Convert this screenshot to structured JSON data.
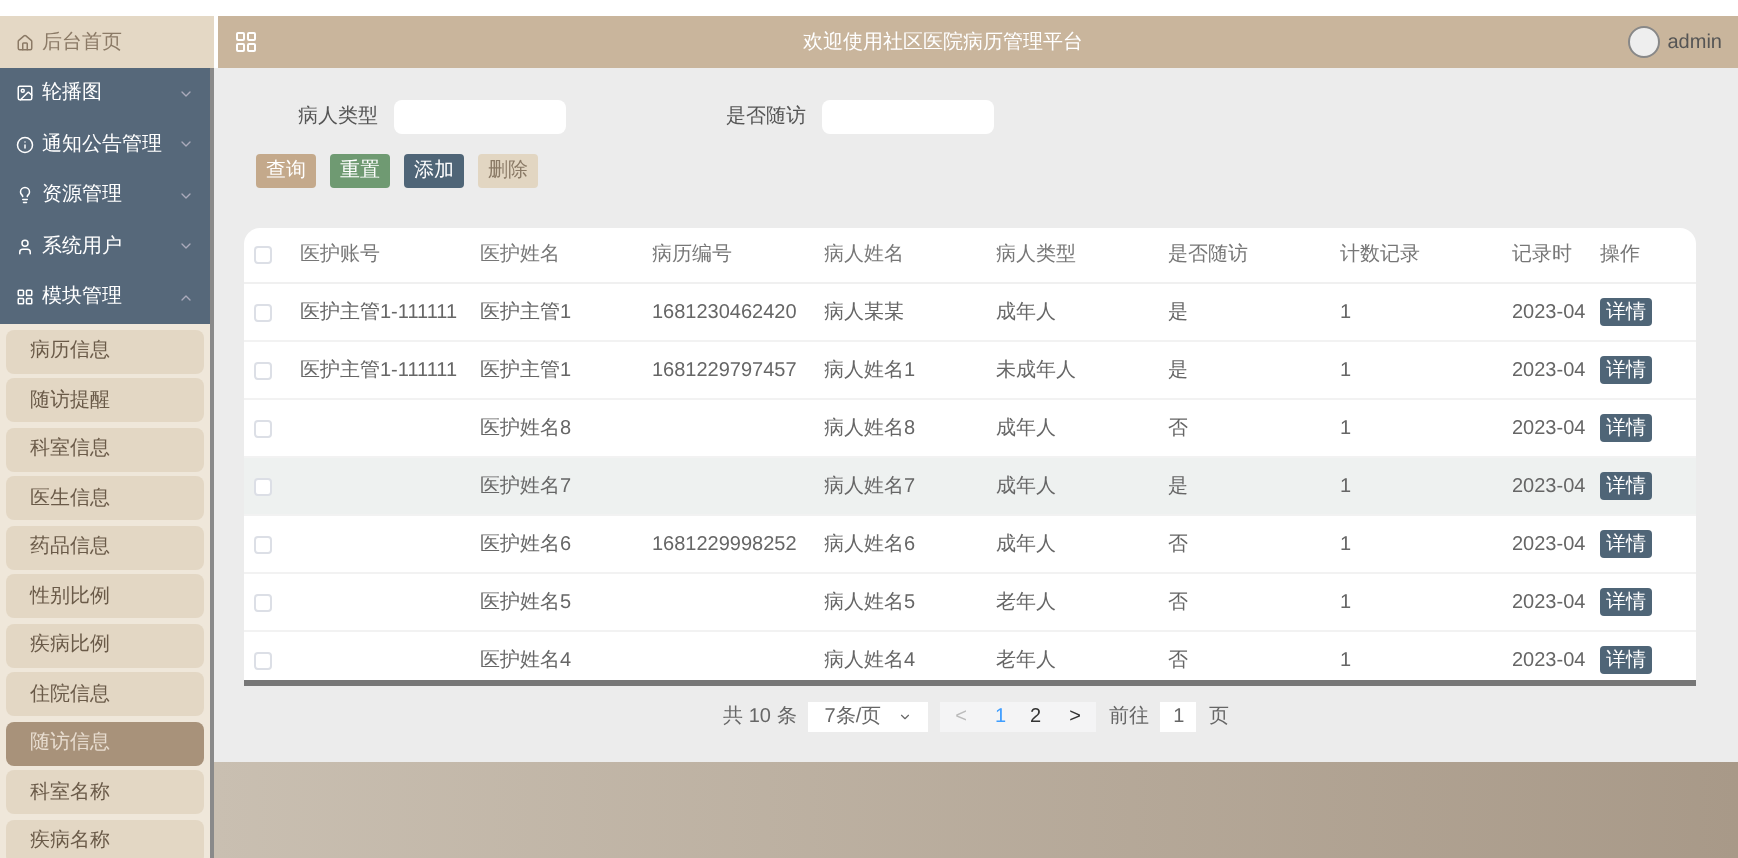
{
  "header": {
    "home": "后台首页",
    "title": "欢迎使用社区医院病历管理平台",
    "user": "admin"
  },
  "sidebar": {
    "groups": [
      {
        "label": "轮播图",
        "expanded": false
      },
      {
        "label": "通知公告管理",
        "expanded": false
      },
      {
        "label": "资源管理",
        "expanded": false
      },
      {
        "label": "系统用户",
        "expanded": false
      },
      {
        "label": "模块管理",
        "expanded": true,
        "children": [
          {
            "label": "病历信息",
            "selected": false
          },
          {
            "label": "随访提醒",
            "selected": false
          },
          {
            "label": "科室信息",
            "selected": false
          },
          {
            "label": "医生信息",
            "selected": false
          },
          {
            "label": "药品信息",
            "selected": false
          },
          {
            "label": "性别比例",
            "selected": false
          },
          {
            "label": "疾病比例",
            "selected": false
          },
          {
            "label": "住院信息",
            "selected": false
          },
          {
            "label": "随访信息",
            "selected": true
          },
          {
            "label": "科室名称",
            "selected": false
          },
          {
            "label": "疾病名称",
            "selected": false
          }
        ]
      }
    ]
  },
  "filters": [
    {
      "label": "病人类型"
    },
    {
      "label": "是否随访"
    }
  ],
  "buttons": [
    {
      "label": "查询",
      "kind": "search",
      "disabled": false
    },
    {
      "label": "重置",
      "kind": "reset",
      "disabled": false
    },
    {
      "label": "添加",
      "kind": "add",
      "disabled": false
    },
    {
      "label": "删除",
      "kind": "delete",
      "disabled": true
    }
  ],
  "table": {
    "select_all_checked": false,
    "columns": [
      "医护账号",
      "医护姓名",
      "病历编号",
      "病人姓名",
      "病人类型",
      "是否随访",
      "计数记录",
      "记录时",
      "操作"
    ],
    "rows": [
      {
        "checked": false,
        "hovered": false,
        "cells": [
          "医护主管1-111111",
          "医护主管1",
          "1681230462420",
          "病人某某",
          "成年人",
          "是",
          "1",
          "2023-04"
        ],
        "action": "详情"
      },
      {
        "checked": false,
        "hovered": false,
        "cells": [
          "医护主管1-111111",
          "医护主管1",
          "1681229797457",
          "病人姓名1",
          "未成年人",
          "是",
          "1",
          "2023-04"
        ],
        "action": "详情"
      },
      {
        "checked": false,
        "hovered": false,
        "cells": [
          "",
          "医护姓名8",
          "",
          "病人姓名8",
          "成年人",
          "否",
          "1",
          "2023-04"
        ],
        "action": "详情"
      },
      {
        "checked": false,
        "hovered": true,
        "cells": [
          "",
          "医护姓名7",
          "",
          "病人姓名7",
          "成年人",
          "是",
          "1",
          "2023-04"
        ],
        "action": "详情"
      },
      {
        "checked": false,
        "hovered": false,
        "cells": [
          "",
          "医护姓名6",
          "1681229998252",
          "病人姓名6",
          "成年人",
          "否",
          "1",
          "2023-04"
        ],
        "action": "详情"
      },
      {
        "checked": false,
        "hovered": false,
        "cells": [
          "",
          "医护姓名5",
          "",
          "病人姓名5",
          "老年人",
          "否",
          "1",
          "2023-04"
        ],
        "action": "详情"
      },
      {
        "checked": false,
        "hovered": false,
        "cells": [
          "",
          "医护姓名4",
          "",
          "病人姓名4",
          "老年人",
          "否",
          "1",
          "2023-04"
        ],
        "action": "详情"
      }
    ]
  },
  "pagination": {
    "total": "共 10 条",
    "page_size": "7条/页",
    "prev": "<",
    "pages": [
      {
        "label": "1",
        "selected": true
      },
      {
        "label": "2",
        "selected": false
      }
    ],
    "next": ">",
    "goto_label": "前往",
    "goto_value": "1",
    "goto_unit": "页"
  }
}
